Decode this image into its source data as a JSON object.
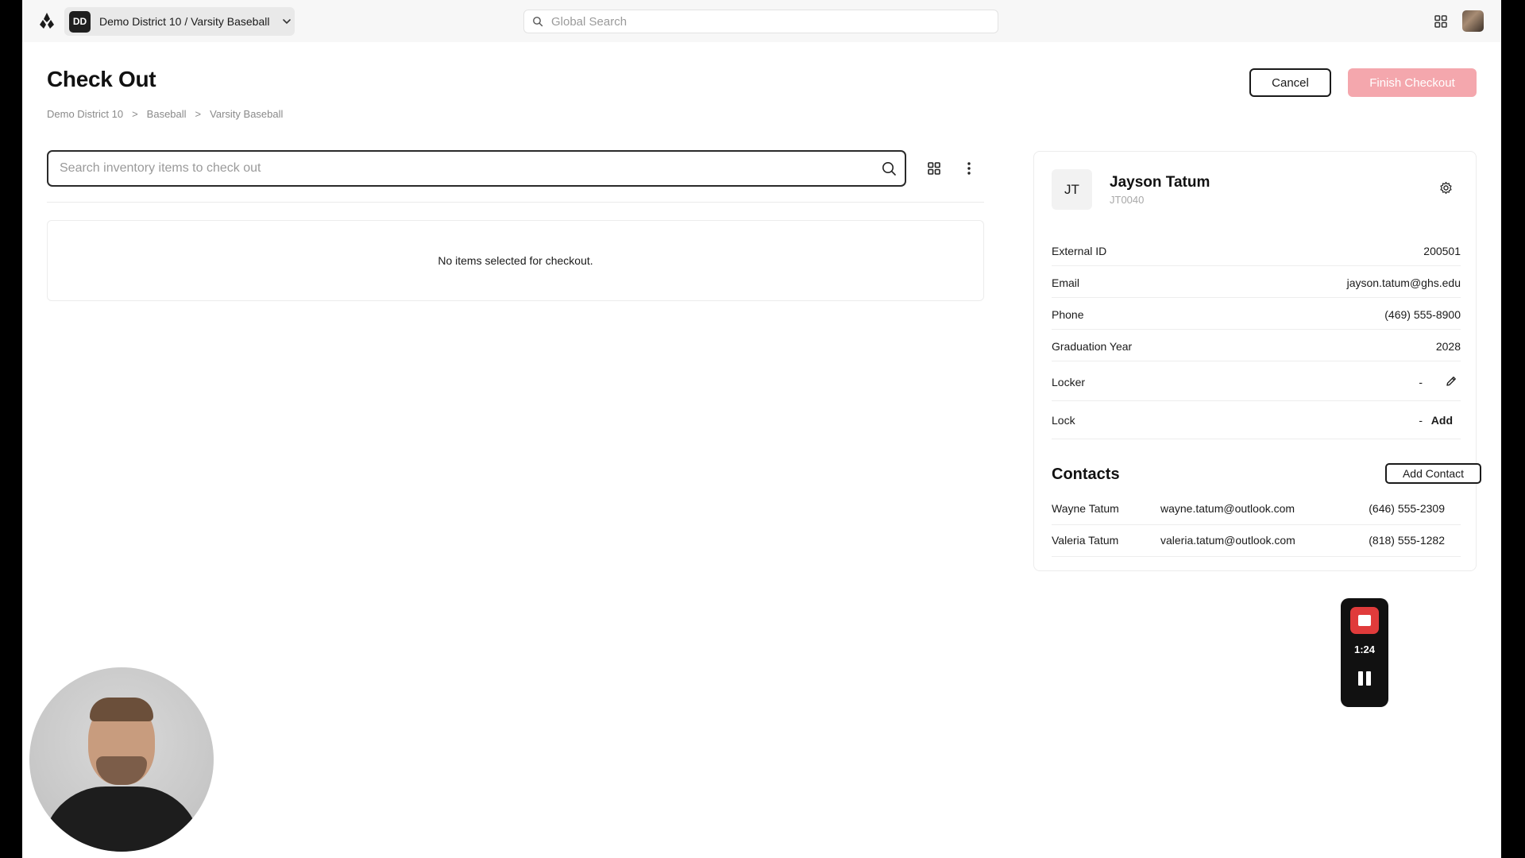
{
  "topbar": {
    "org_badge": "DD",
    "org_name": "Demo District 10 / Varsity Baseball",
    "search_placeholder": "Global Search"
  },
  "page": {
    "title": "Check Out",
    "breadcrumb": [
      "Demo District 10",
      "Baseball",
      "Varsity Baseball"
    ],
    "breadcrumb_sep": ">",
    "cancel_label": "Cancel",
    "finish_label": "Finish Checkout"
  },
  "inventory": {
    "search_placeholder": "Search inventory items to check out",
    "empty_message": "No items selected for checkout."
  },
  "profile": {
    "initials": "JT",
    "name": "Jayson Tatum",
    "code": "JT0040",
    "fields": [
      {
        "label": "External ID",
        "value": "200501"
      },
      {
        "label": "Email",
        "value": "jayson.tatum@ghs.edu"
      },
      {
        "label": "Phone",
        "value": "(469) 555-8900"
      },
      {
        "label": "Graduation Year",
        "value": "2028"
      },
      {
        "label": "Locker",
        "value": "-"
      },
      {
        "label": "Lock",
        "value": "-",
        "action": "Add"
      }
    ],
    "contacts_title": "Contacts",
    "add_contact_label": "Add Contact",
    "contacts": [
      {
        "name": "Wayne Tatum",
        "email": "wayne.tatum@outlook.com",
        "phone": "(646) 555-2309"
      },
      {
        "name": "Valeria Tatum",
        "email": "valeria.tatum@outlook.com",
        "phone": "(818) 555-1282"
      }
    ]
  },
  "recording": {
    "time": "1:24",
    "stop_color": "#e03b3b"
  },
  "colors": {
    "accent_disabled": "#f4a7ad",
    "topbar_bg": "#f7f7f7"
  }
}
